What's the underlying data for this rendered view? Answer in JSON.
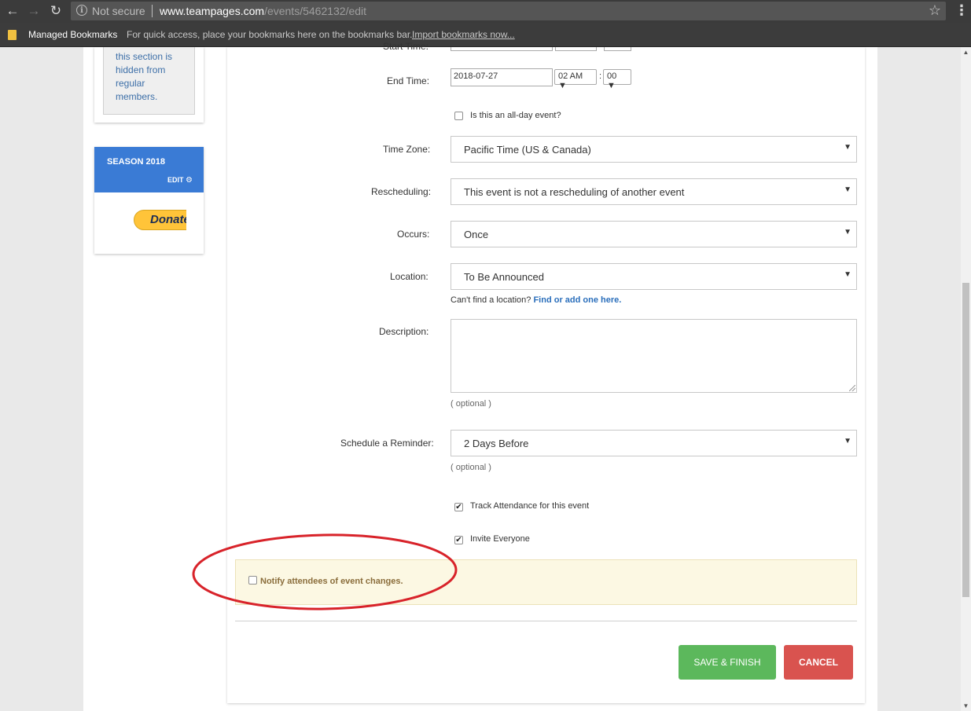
{
  "browser": {
    "security_label": "Not secure",
    "url_host": "www.teampages.com",
    "url_path": "/events/5462132/edit",
    "bookmarks_title": "Managed Bookmarks",
    "bookmarks_hint": "For quick access, place your bookmarks here on the bookmarks bar.",
    "bookmarks_import": "Import bookmarks now..."
  },
  "sidebar": {
    "hidden_note": "this section is hidden from regular members.",
    "season_title": "SEASON 2018",
    "season_edit": "EDIT",
    "donate_label": "Donate"
  },
  "form": {
    "start_time_label": "Start Time:",
    "end_time_label": "End Time:",
    "end_date": "2018-07-27",
    "end_hour": "02 AM",
    "time_sep": ":",
    "end_minute": "00",
    "all_day_label": "Is this an all-day event?",
    "timezone_label": "Time Zone:",
    "timezone_value": "Pacific Time (US & Canada)",
    "rescheduling_label": "Rescheduling:",
    "rescheduling_value": "This event is not a rescheduling of another event",
    "occurs_label": "Occurs:",
    "occurs_value": "Once",
    "location_label": "Location:",
    "location_value": "To Be Announced",
    "location_help": "Can't find a location?",
    "location_link": "Find or add one here.",
    "description_label": "Description:",
    "description_hint": "( optional )",
    "reminder_label": "Schedule a Reminder:",
    "reminder_value": "2 Days Before",
    "reminder_hint": "( optional )",
    "track_attendance_label": "Track Attendance for this event",
    "track_attendance_checked": true,
    "invite_everyone_label": "Invite Everyone",
    "invite_everyone_checked": true,
    "notify_label": "Notify attendees of event changes.",
    "notify_checked": false
  },
  "actions": {
    "save_label": "SAVE & FINISH",
    "cancel_label": "CANCEL"
  },
  "colors": {
    "accent_blue": "#3a7bd5",
    "save_green": "#5cb85c",
    "cancel_red": "#d9534f",
    "annotation_red": "#d8232a",
    "notice_bg": "#fcf8e3"
  }
}
